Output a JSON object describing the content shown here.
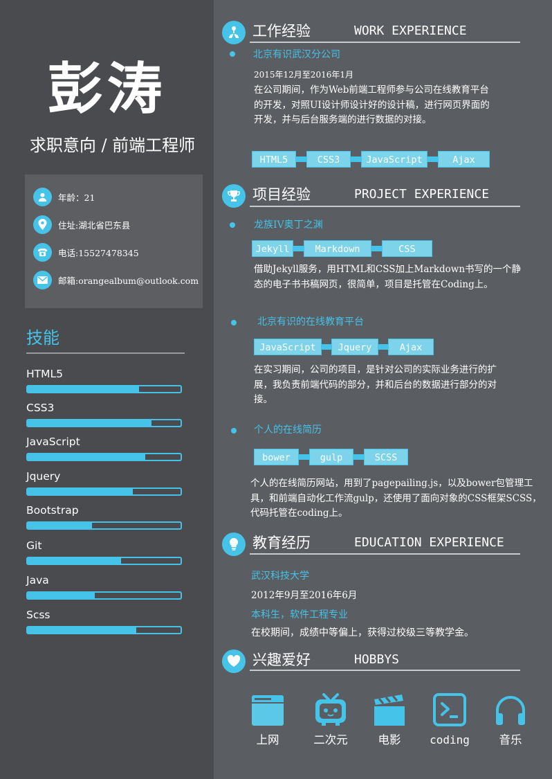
{
  "profile": {
    "name": "彭涛",
    "intent": "求职意向 / 前端工程师",
    "age": "年龄：21",
    "address": "住址:湖北省巴东县",
    "phone": "电话:15527478345",
    "email": "邮箱:orangealbum@outlook.com"
  },
  "skills": {
    "title": "技能",
    "items": [
      {
        "name": "HTML5",
        "level": 0.73
      },
      {
        "name": "CSS3",
        "level": 0.81
      },
      {
        "name": "JavaScript",
        "level": 0.77
      },
      {
        "name": "Jquery",
        "level": 0.69
      },
      {
        "name": "Bootstrap",
        "level": 0.42
      },
      {
        "name": "Git",
        "level": 0.61
      },
      {
        "name": "Java",
        "level": 0.44
      },
      {
        "name": "Scss",
        "level": 0.71
      }
    ]
  },
  "work": {
    "title_cn": "工作经验",
    "title_en": "WORK EXPERIENCE",
    "company": "北京有识武汉分公司",
    "period": "2015年12月至2016年1月",
    "desc": "在公司期间，作为Web前端工程师参与公司在线教育平台的开发，对照UI设计师设计好的设计稿，进行网页界面的开发，并与后台服务端的进行数据的对接。",
    "tags": [
      "HTML5",
      "CSS3",
      "JavaScript",
      "Ajax"
    ]
  },
  "projects": {
    "title_cn": "项目经验",
    "title_en": "PROJECT EXPERIENCE",
    "items": [
      {
        "name": "龙族IV奥丁之渊",
        "tags": [
          "Jekyll",
          "Markdown",
          "CSS"
        ],
        "desc": "借助Jekyll服务，用HTML和CSS加上Markdown书写的一个静态的电子书书稿网页，很简单，项目是托管在Coding上。"
      },
      {
        "name": "北京有识的在线教育平台",
        "tags": [
          "JavaScript",
          "Jquery",
          "Ajax"
        ],
        "desc": "在实习期间，公司的项目，是针对公司的实际业务进行的扩展，我负责前端代码的部分，并和后台的数据进行部分的对接。"
      },
      {
        "name": "个人的在线简历",
        "tags": [
          "bower",
          "gulp",
          "SCSS"
        ],
        "desc": "个人的在线简历网站，用到了pagepailing.js，以及bower包管理工具，和前端自动化工作流gulp，还使用了面向对象的CSS框架SCSS，代码托管在coding上。"
      }
    ]
  },
  "education": {
    "title_cn": "教育经历",
    "title_en": "EDUCATION EXPERIENCE",
    "school": "武汉科技大学",
    "period": "2012年9月至2016年6月",
    "major": "本科生，软件工程专业",
    "desc": "在校期间，成绩中等偏上，获得过校级三等教学金。"
  },
  "hobbies": {
    "title_cn": "兴趣爱好",
    "title_en": "HOBBYS",
    "items": [
      {
        "label": "上网",
        "icon": "browser-icon"
      },
      {
        "label": "二次元",
        "icon": "bilibili-tv-icon"
      },
      {
        "label": "电影",
        "icon": "clapperboard-icon"
      },
      {
        "label": "coding",
        "icon": "terminal-icon"
      },
      {
        "label": "音乐",
        "icon": "headphones-icon"
      }
    ]
  },
  "colors": {
    "accent": "#45c3e8",
    "sidebar": "#4a4b4f",
    "background": "#5a5d62",
    "tag": "#7dd3ea"
  }
}
